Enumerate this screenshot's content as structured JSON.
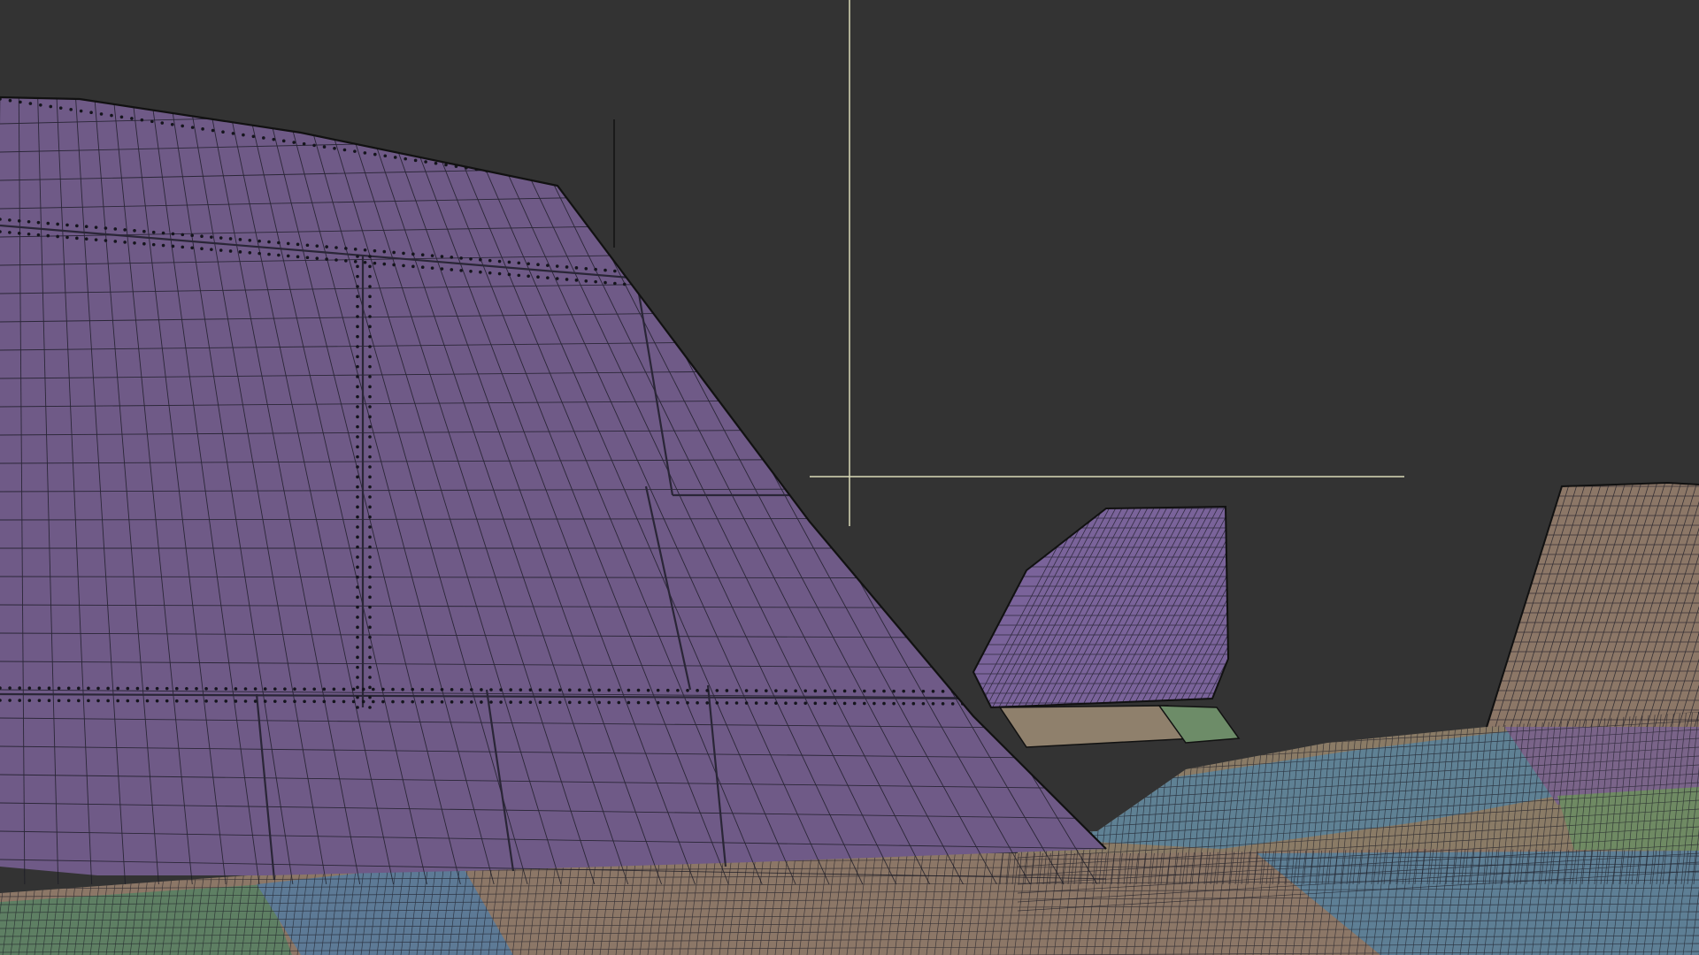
{
  "viewport": {
    "background": "#333333",
    "cursor_color": "#d9d9b8",
    "mesh_wire_color": "#1a1a24"
  },
  "materials": {
    "fin_purple": "#6f5a87",
    "fin_purple_light": "#7a639a",
    "hull_tan": "#8c7767",
    "hull_blue": "#5e7f95",
    "hull_green": "#5e7f63",
    "hull_tan_light": "#8f806c",
    "hull_purple": "#7a6489"
  }
}
